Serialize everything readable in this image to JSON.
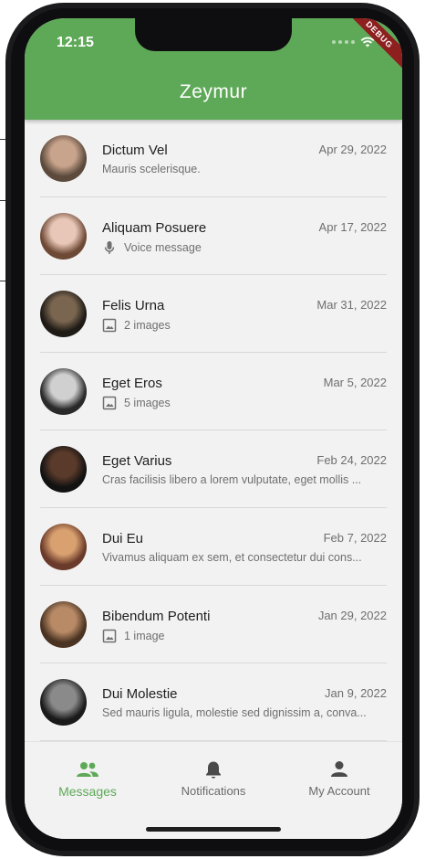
{
  "status_bar": {
    "time": "12:15",
    "debug_label": "DEBUG"
  },
  "app_bar": {
    "title": "Zeymur"
  },
  "conversations": [
    {
      "name": "Dictum Vel",
      "date": "Apr 29, 2022",
      "preview": "Mauris scelerisque.",
      "preview_icon": "",
      "avatar_colors": [
        "#c9a48c",
        "#5c4a3c"
      ]
    },
    {
      "name": "Aliquam Posuere",
      "date": "Apr 17, 2022",
      "preview": "Voice message",
      "preview_icon": "mic-icon",
      "avatar_colors": [
        "#e9c7b8",
        "#6e4a36"
      ]
    },
    {
      "name": "Felis Urna",
      "date": "Mar 31, 2022",
      "preview": "2 images",
      "preview_icon": "image-icon",
      "avatar_colors": [
        "#7a6650",
        "#1e1a16"
      ]
    },
    {
      "name": "Eget Eros",
      "date": "Mar 5, 2022",
      "preview": "5 images",
      "preview_icon": "image-icon",
      "avatar_colors": [
        "#d0d0d0",
        "#2a2a2a"
      ]
    },
    {
      "name": "Eget Varius",
      "date": "Feb 24, 2022",
      "preview": "Cras facilisis libero a lorem vulputate, eget mollis ...",
      "preview_icon": "",
      "avatar_colors": [
        "#5a3a2a",
        "#121212"
      ]
    },
    {
      "name": "Dui Eu",
      "date": "Feb 7, 2022",
      "preview": "Vivamus aliquam ex sem, et consectetur dui cons...",
      "preview_icon": "",
      "avatar_colors": [
        "#d9a070",
        "#6a3a2a"
      ]
    },
    {
      "name": "Bibendum Potenti",
      "date": "Jan 29, 2022",
      "preview": "1 image",
      "preview_icon": "image-icon",
      "avatar_colors": [
        "#b88a66",
        "#4a3322"
      ]
    },
    {
      "name": "Dui Molestie",
      "date": "Jan 9, 2022",
      "preview": "Sed mauris ligula, molestie sed dignissim a, conva...",
      "preview_icon": "",
      "avatar_colors": [
        "#8a8a8a",
        "#1a1a1a"
      ]
    }
  ],
  "bottom_nav": [
    {
      "label": "Messages",
      "icon": "people-icon",
      "active": true
    },
    {
      "label": "Notifications",
      "icon": "bell-icon",
      "active": false
    },
    {
      "label": "My Account",
      "icon": "person-icon",
      "active": false
    }
  ],
  "colors": {
    "accent": "#5ea957",
    "background": "#f2f2f2",
    "text_secondary": "#6f6f6f"
  }
}
